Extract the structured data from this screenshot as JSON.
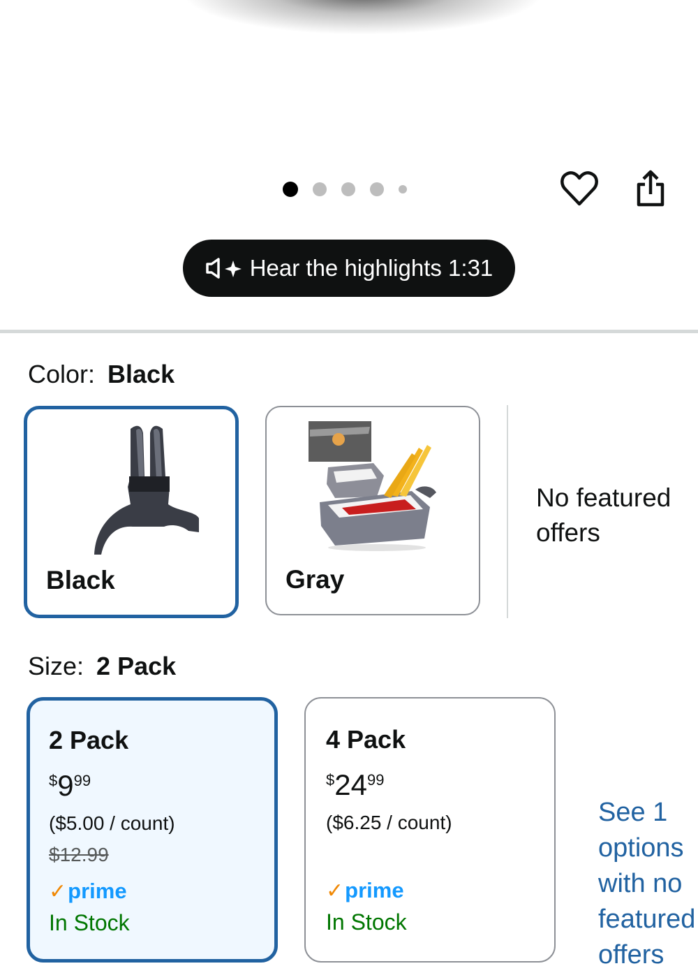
{
  "carousel": {
    "total_images": 5,
    "active_index": 0
  },
  "audio": {
    "label": "Hear the highlights 1:31"
  },
  "color": {
    "label": "Color:",
    "selected": "Black",
    "options": [
      {
        "name": "Black",
        "selected": true
      },
      {
        "name": "Gray",
        "selected": false
      }
    ],
    "no_featured": "No featured offers"
  },
  "size": {
    "label": "Size:",
    "selected": "2 Pack",
    "options": [
      {
        "name": "2 Pack",
        "price_symbol": "$",
        "price_whole": "9",
        "price_fraction": "99",
        "per_count": "($5.00 / count)",
        "list_price": "$12.99",
        "prime": "prime",
        "stock": "In Stock",
        "selected": true
      },
      {
        "name": "4 Pack",
        "price_symbol": "$",
        "price_whole": "24",
        "price_fraction": "99",
        "per_count": "($6.25 / count)",
        "list_price": "",
        "prime": "prime",
        "stock": "In Stock",
        "selected": false
      }
    ],
    "see_offers": "See 1 options with no featured offers"
  },
  "colors": {
    "accent": "#2162a1",
    "prime": "#1399ff",
    "in_stock": "#007600",
    "pill": "#0f1111"
  }
}
